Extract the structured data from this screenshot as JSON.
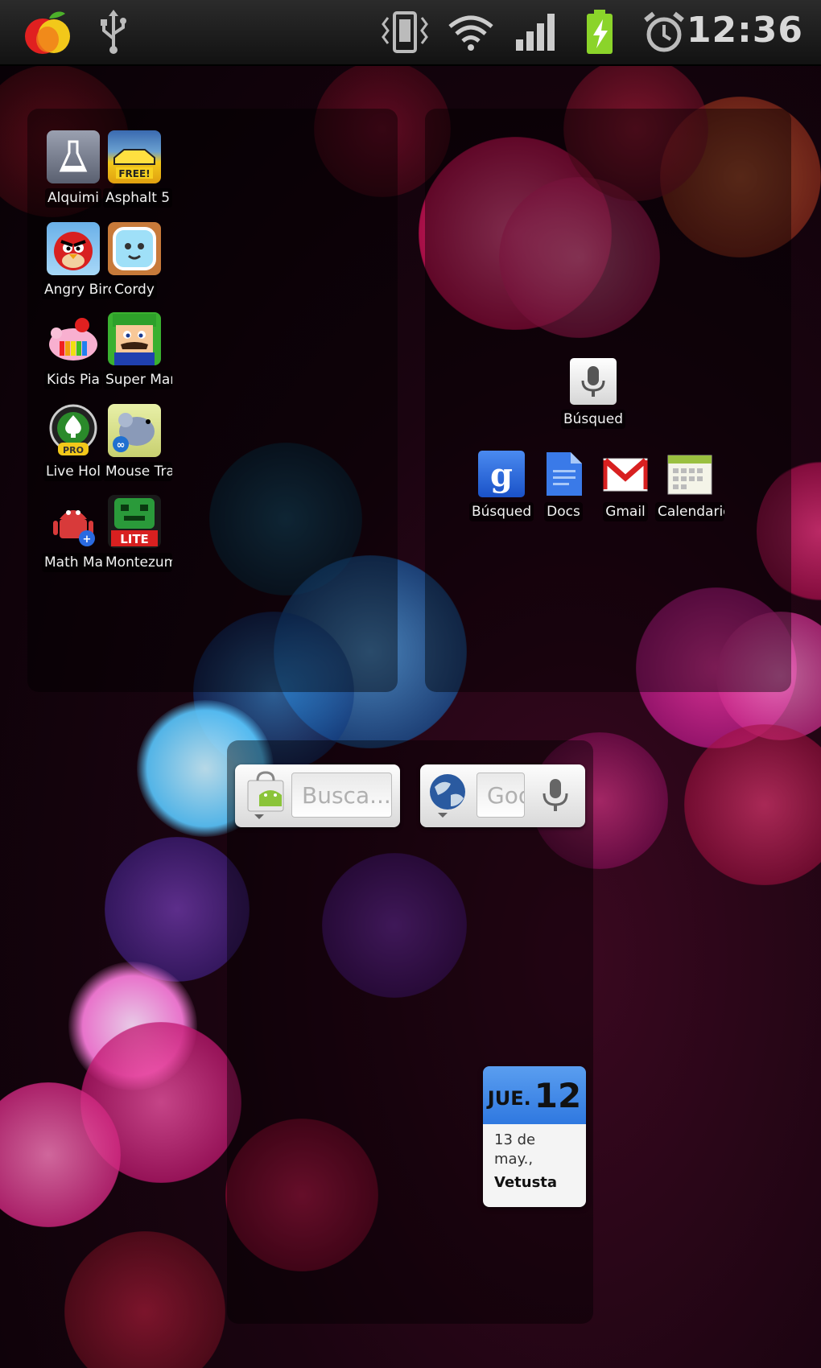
{
  "status_bar": {
    "time": "12:36",
    "icons": [
      "fruit-app-notification-icon",
      "usb-icon",
      "vibrate-icon",
      "wifi-icon",
      "signal-icon",
      "battery-charging-icon",
      "alarm-icon"
    ]
  },
  "apps_folder": {
    "apps": [
      {
        "label": "Alquimi",
        "icon": "alchemy-flask-icon"
      },
      {
        "label": "Asphalt 5",
        "icon": "asphalt-car-icon"
      },
      {
        "label": "Angry Bird",
        "icon": "angry-birds-icon"
      },
      {
        "label": "Cordy",
        "icon": "cordy-robot-icon"
      },
      {
        "label": "Kids Pia",
        "icon": "kids-piano-icon"
      },
      {
        "label": "Super Mar",
        "icon": "super-mario-icon"
      },
      {
        "label": "Live Hol",
        "icon": "live-holdem-icon"
      },
      {
        "label": "Mouse Tra",
        "icon": "mouse-trap-icon"
      },
      {
        "label": "Math Ma",
        "icon": "math-maniac-icon"
      },
      {
        "label": "Montezum",
        "icon": "montezuma-lite-icon"
      }
    ]
  },
  "google_folder": {
    "voice_search": {
      "label": "Búsqued",
      "icon": "microphone-icon"
    },
    "apps": [
      {
        "label": "Búsqued",
        "icon": "google-search-icon"
      },
      {
        "label": "Docs",
        "icon": "docs-icon"
      },
      {
        "label": "Gmail",
        "icon": "gmail-icon"
      },
      {
        "label": "Calendario",
        "icon": "calendar-icon"
      }
    ]
  },
  "widgets": {
    "market_search": {
      "placeholder": "Busca..."
    },
    "google_search": {
      "placeholder": "Goo"
    },
    "calendar": {
      "day_name": "JUE.",
      "day_number": "12",
      "event_date": "13 de may.,",
      "event_title": "Vetusta"
    }
  }
}
